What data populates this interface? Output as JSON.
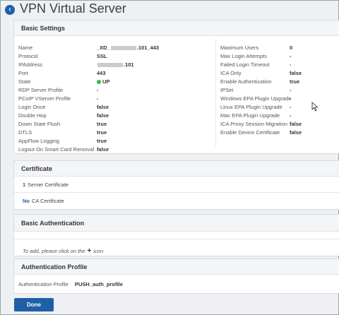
{
  "header": {
    "title": "VPN Virtual Server"
  },
  "basic_settings": {
    "title": "Basic Settings",
    "left": [
      {
        "label": "Name",
        "value_prefix": "_XD_",
        "value_suffix": ".101_443",
        "redacted": true
      },
      {
        "label": "Protocol",
        "value": "SSL"
      },
      {
        "label": "IPAddress",
        "value_suffix": ".101",
        "redacted": true
      },
      {
        "label": "Port",
        "value": "443"
      },
      {
        "label": "State",
        "value": "UP",
        "status": true
      },
      {
        "label": "RDP Server Profile",
        "value": "-"
      },
      {
        "label": "PCoIP VServer Profile",
        "value": "-"
      },
      {
        "label": "Login Once",
        "value": "false"
      },
      {
        "label": "Double Hop",
        "value": "false"
      },
      {
        "label": "Down State Flush",
        "value": "true"
      },
      {
        "label": "DTLS",
        "value": "true"
      },
      {
        "label": "AppFlow Logging",
        "value": "true"
      },
      {
        "label": "Logout On Smart Card Removal",
        "value": "false"
      }
    ],
    "right": [
      {
        "label": "Maximum Users",
        "value": "0"
      },
      {
        "label": "Max Login Attempts",
        "value": "-"
      },
      {
        "label": "Failed Login Timeout",
        "value": "-"
      },
      {
        "label": "ICA Only",
        "value": "false"
      },
      {
        "label": "Enable Authentication",
        "value": "true"
      },
      {
        "label": "IPSet",
        "value": "-"
      },
      {
        "label": "Windows EPA Plugin Upgrade",
        "value": "-"
      },
      {
        "label": "Linux EPA Plugin Upgrade",
        "value": "-"
      },
      {
        "label": "Mac EPA Plugin Upgrade",
        "value": "-"
      },
      {
        "label": "ICA Proxy Session Migration",
        "value": "false"
      },
      {
        "label": "Enable Device Certificate",
        "value": "false"
      }
    ],
    "status_color": "#3ab54a"
  },
  "certificate": {
    "title": "Certificate",
    "server": {
      "count": "1",
      "label": "Server Certificate"
    },
    "ca": {
      "count": "No",
      "label": "CA Certificate"
    }
  },
  "basic_auth": {
    "title": "Basic Authentication",
    "hint_before": "To add, please click on the",
    "hint_after": "icon",
    "icon": "plus-icon"
  },
  "auth_profile": {
    "title": "Authentication Profile",
    "label": "Authentication Profile",
    "value": "PUSH_auth_profile"
  },
  "footer": {
    "done_label": "Done"
  },
  "colors": {
    "accent": "#1f5fa8",
    "status_up": "#3ab54a"
  }
}
